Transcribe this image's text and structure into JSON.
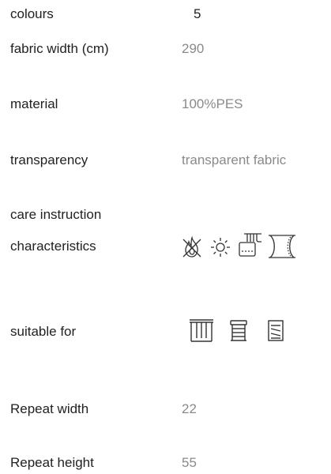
{
  "specs": {
    "colours": {
      "label": "colours",
      "value": "5"
    },
    "fabric_width": {
      "label": "fabric width (cm)",
      "value": "290"
    },
    "material": {
      "label": "material",
      "value": "100%PES"
    },
    "transparency": {
      "label": "transparency",
      "value": "transparent fabric"
    },
    "care": {
      "label": "care instruction"
    },
    "characteristics": {
      "label": "characteristics",
      "icons": [
        "flame-retardant-icon",
        "sun-resistant-icon",
        "washable-icon",
        "sheer-curtain-icon"
      ]
    },
    "suitable_for": {
      "label": "suitable for",
      "icons": [
        "curtain-icon",
        "roller-blind-icon",
        "roman-blind-icon"
      ]
    },
    "repeat_width": {
      "label": "Repeat width",
      "value": "22"
    },
    "repeat_height": {
      "label": "Repeat height",
      "value": "55"
    }
  }
}
